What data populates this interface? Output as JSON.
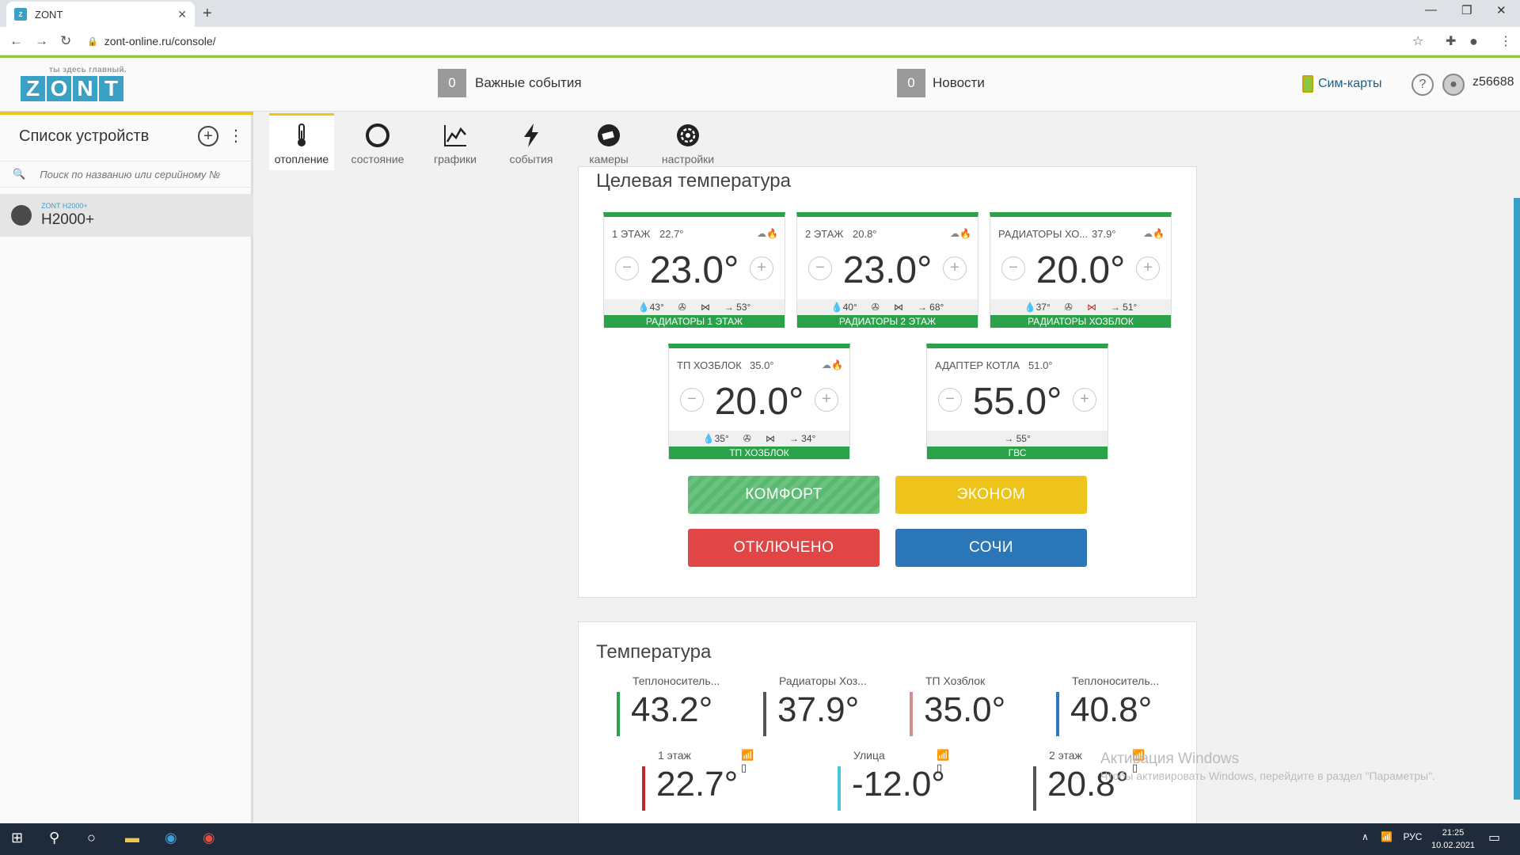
{
  "browser": {
    "tab_title": "ZONT",
    "url": "zont-online.ru/console/"
  },
  "header": {
    "slogan": "ты здесь главный.",
    "logo_letters": [
      "Z",
      "O",
      "N",
      "T"
    ],
    "events_count": "0",
    "events_label": "Важные события",
    "news_count": "0",
    "news_label": "Новости",
    "sim_label": "Сим-карты",
    "user": "z56688"
  },
  "sidebar": {
    "title": "Список устройств",
    "search_placeholder": "Поиск по названию или серийному №",
    "device": {
      "model": "ZONT H2000+",
      "name": "H2000+"
    }
  },
  "toolbar": {
    "tabs": [
      {
        "label": "отопление",
        "icon": "thermometer-icon",
        "active": true
      },
      {
        "label": "состояние",
        "icon": "status-icon"
      },
      {
        "label": "графики",
        "icon": "chart-icon"
      },
      {
        "label": "события",
        "icon": "lightning-icon"
      },
      {
        "label": "камеры",
        "icon": "camera-icon"
      },
      {
        "label": "настройки",
        "icon": "gear-icon"
      }
    ]
  },
  "target": {
    "title": "Целевая температура",
    "cards": [
      {
        "name": "1 ЭТАЖ",
        "current": "22.7°",
        "target": "23.0°",
        "b1": "43°",
        "b3": "53°",
        "label": "РАДИАТОРЫ 1 ЭТАЖ"
      },
      {
        "name": "2 ЭТАЖ",
        "current": "20.8°",
        "target": "23.0°",
        "b1": "40°",
        "b3": "68°",
        "label": "РАДИАТОРЫ 2 ЭТАЖ"
      },
      {
        "name": "РАДИАТОРЫ ХО...",
        "current": "37.9°",
        "target": "20.0°",
        "b1": "37°",
        "b3": "51°",
        "label": "РАДИАТОРЫ ХОЗБЛОК"
      },
      {
        "name": "ТП ХОЗБЛОК",
        "current": "35.0°",
        "target": "20.0°",
        "b1": "35°",
        "b3": "34°",
        "label": "ТП ХОЗБЛОК"
      },
      {
        "name": "АДАПТЕР КОТЛА",
        "current": "51.0°",
        "target": "55.0°",
        "b3": "55°",
        "label": "ГВС"
      }
    ],
    "modes": [
      {
        "label": "КОМФОРТ",
        "color": "#5bb870"
      },
      {
        "label": "ЭКОНОМ",
        "color": "#eec31c"
      },
      {
        "label": "ОТКЛЮЧЕНО",
        "color": "#e04646"
      },
      {
        "label": "СОЧИ",
        "color": "#2b77b8"
      }
    ]
  },
  "temperature": {
    "title": "Температура",
    "sensors": [
      {
        "label": "Теплоноситель...",
        "value": "43.2°",
        "color": "#2ba24a"
      },
      {
        "label": "Радиаторы Хоз...",
        "value": "37.9°",
        "color": "#555555"
      },
      {
        "label": "ТП Хозблок",
        "value": "35.0°",
        "color": "#d98a8a"
      },
      {
        "label": "Теплоноситель...",
        "value": "40.8°",
        "color": "#2b77b8"
      },
      {
        "label": "1 этаж",
        "value": "22.7°",
        "color": "#c0282a"
      },
      {
        "label": "Улица",
        "value": "-12.0°",
        "color": "#44c8d8"
      },
      {
        "label": "2 этаж",
        "value": "20.8°",
        "color": "#555555"
      }
    ]
  },
  "watermark": {
    "line1": "Активация Windows",
    "line2": "Чтобы активировать Windows, перейдите в раздел \"Параметры\"."
  },
  "taskbar": {
    "lang": "РУС",
    "time": "21:25",
    "date": "10.02.2021"
  }
}
